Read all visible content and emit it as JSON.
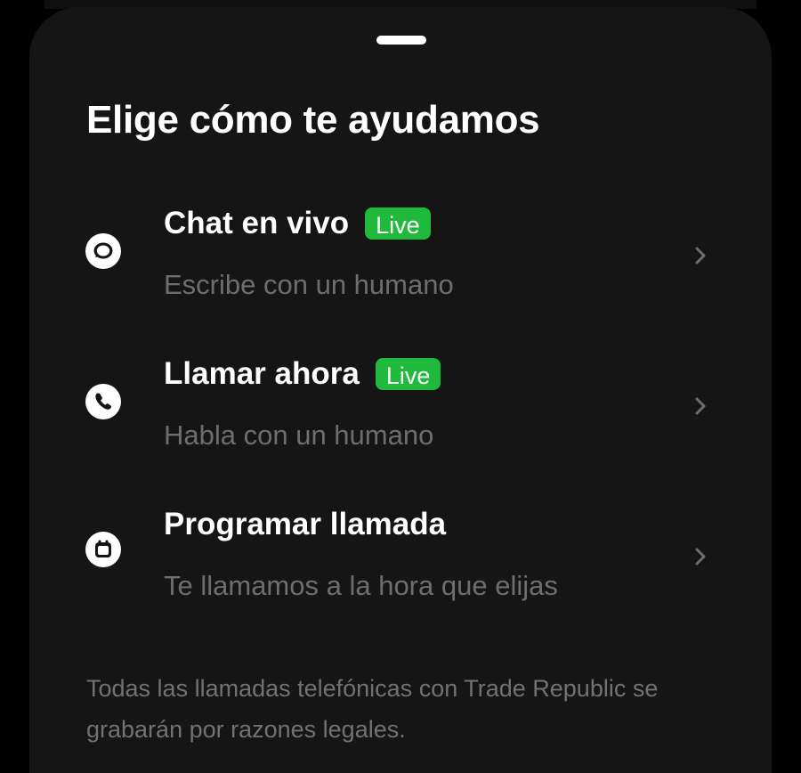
{
  "sheet": {
    "title": "Elige cómo te ayudamos",
    "options": [
      {
        "label": "Chat en vivo",
        "badge": "Live",
        "subtitle": "Escribe con un humano",
        "icon": "chat-bubble-icon"
      },
      {
        "label": "Llamar ahora",
        "badge": "Live",
        "subtitle": "Habla con un humano",
        "icon": "phone-icon"
      },
      {
        "label": "Programar llamada",
        "subtitle": "Te llamamos a la hora que elijas",
        "icon": "calendar-icon"
      }
    ],
    "disclaimer": "Todas las llamadas telefónicas con Trade Republic se grabarán por razones legales."
  },
  "colors": {
    "background": "#151515",
    "live_badge": "#1fba3b",
    "text_primary": "#ffffff",
    "text_secondary": "#6e6e6e"
  }
}
